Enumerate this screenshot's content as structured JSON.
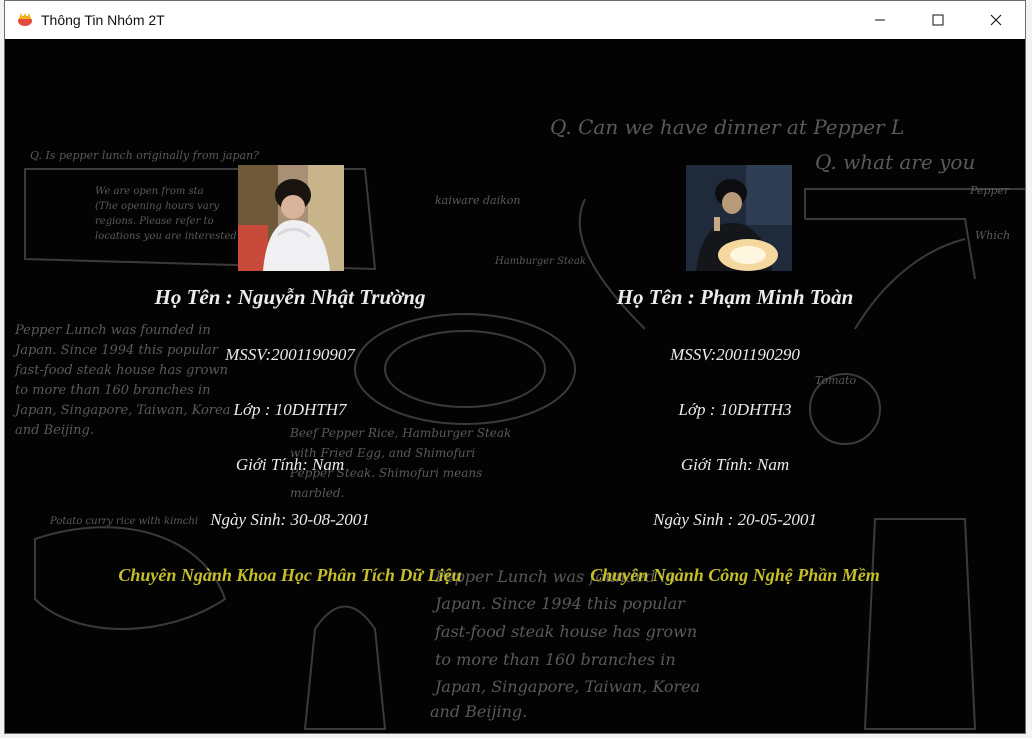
{
  "window": {
    "title": "Thông Tin Nhóm 2T",
    "controls": [
      "minimize-icon",
      "maximize-icon",
      "close-icon"
    ]
  },
  "members": [
    {
      "name_line": "Họ Tên : Nguyễn Nhật Trường",
      "mssv_line": "MSSV:2001190907",
      "class_line": "Lớp : 10DHTH7",
      "gender_line": "Giới Tính: Nam",
      "birth_line": "Ngày Sinh: 30-08-2001",
      "major_line": "Chuyên Ngành  Khoa Học Phân Tích Dữ Liệu"
    },
    {
      "name_line": "Họ Tên : Phạm Minh Toàn",
      "mssv_line": "MSSV:2001190290",
      "class_line": "Lớp : 10DHTH3",
      "gender_line": "Giới Tính: Nam",
      "birth_line": "Ngày Sinh : 20-05-2001",
      "major_line": "Chuyên Ngành Công Nghệ Phần Mềm"
    }
  ],
  "colors": {
    "background": "#030303",
    "text": "#ececec",
    "major": "#c6bf2a",
    "sketch": "#5a5a5a"
  },
  "background_art": {
    "lines": [
      "Q. Can we have dinner at Pepper L",
      "Q. what are you",
      "Q. Is pepper lunch originally from japan?",
      "We are open from sta",
      "(The opening hours vary",
      "regions. Please refer to",
      "locations you are interested",
      "kaiware daikon",
      "Hamburger Steak",
      "Pepper Lunch was founded in",
      "Japan. Since 1994 this popular",
      "fast-food steak house has grown",
      "to more than 160 branches in",
      "Japan, Singapore, Taiwan, Korea",
      "and Beijing.",
      "Beef Pepper Rice, Hamburger Steak",
      "with Fried Egg, and Shimofuri",
      "Pepper Steak. Shimofuri means",
      "marbled.",
      "Tomato",
      "Potato curry rice with kimchi",
      "Pepper Lunch was founded in",
      "Japan. Since 1994 this popular",
      "fast-food steak house has grown",
      "to more than 160 branches in",
      "Japan, Singapore, Taiwan, Korea",
      "and Beijing.",
      "Pepper",
      "Which"
    ]
  }
}
